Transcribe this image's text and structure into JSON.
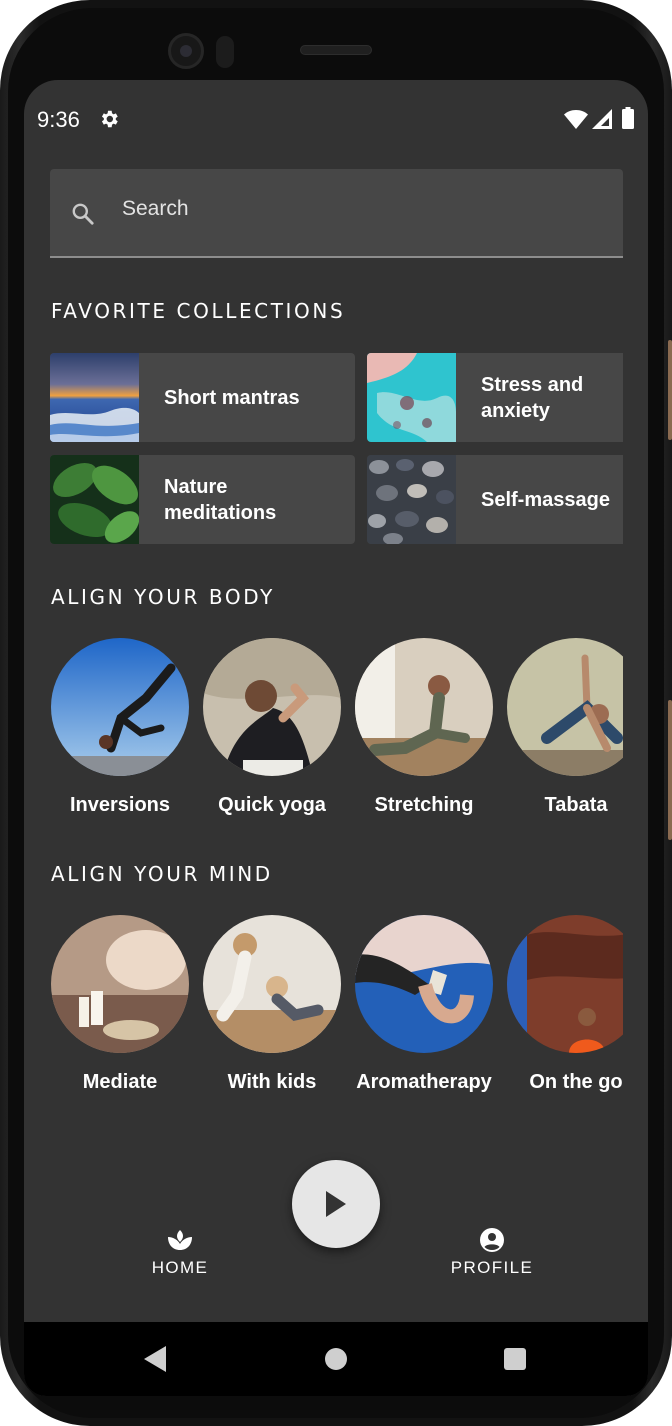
{
  "status_bar": {
    "time": "9:36"
  },
  "search": {
    "placeholder": "Search",
    "value": ""
  },
  "favorite_collections": {
    "title": "FAVORITE COLLECTIONS",
    "items": [
      {
        "label": "Short mantras",
        "image": "ocean-sunset"
      },
      {
        "label": "Stress and\nanxiety",
        "image": "turquoise-coast-aerial"
      },
      {
        "label": "Nature\nmeditations",
        "image": "green-leaves"
      },
      {
        "label": "Self-massage",
        "image": "pebbles"
      }
    ]
  },
  "align_body": {
    "title": "ALIGN YOUR BODY",
    "items": [
      {
        "label": "Inversions",
        "image": "yoga-arm-balance-sky"
      },
      {
        "label": "Quick yoga",
        "image": "woman-stretching-forest"
      },
      {
        "label": "Stretching",
        "image": "woman-floor-stretch"
      },
      {
        "label": "Tabata",
        "image": "man-side-plank"
      }
    ]
  },
  "align_mind": {
    "title": "ALIGN YOUR MIND",
    "items": [
      {
        "label": "Mediate",
        "image": "candles-meditation"
      },
      {
        "label": "With kids",
        "image": "mother-child-floor"
      },
      {
        "label": "Aromatherapy",
        "image": "sage-smudge-hand"
      },
      {
        "label": "On the go",
        "image": "man-red-rock"
      }
    ]
  },
  "bottom_nav": {
    "home": {
      "label": "HOME",
      "icon": "spa-icon"
    },
    "play": {
      "icon": "play-icon"
    },
    "profile": {
      "label": "PROFILE",
      "icon": "account-circle-icon"
    }
  },
  "colors": {
    "screen_background": "#333333",
    "surface": "#474747",
    "fab": "#e6e6e6",
    "text": "#ffffff"
  }
}
